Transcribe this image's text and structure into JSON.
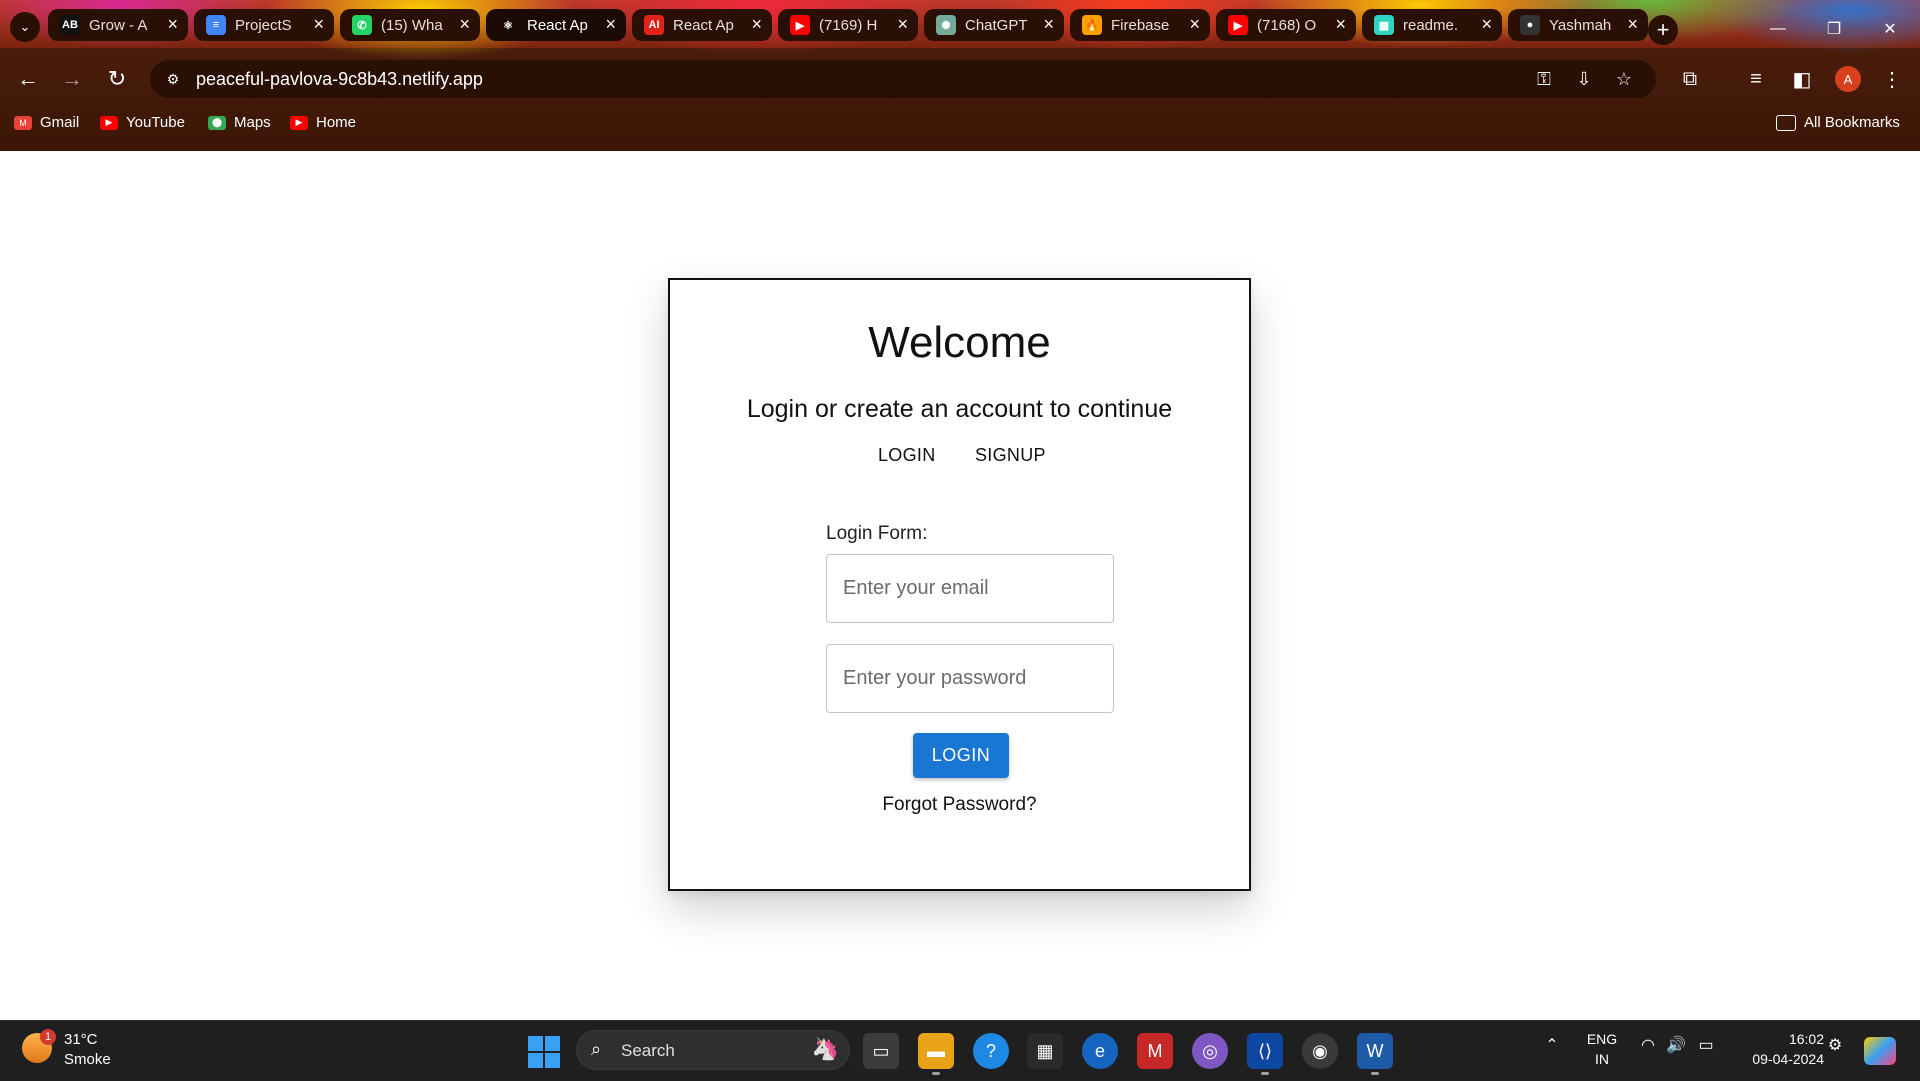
{
  "browser": {
    "tabs": [
      {
        "title": "Grow - A",
        "icon": "ab-icon",
        "color": "#111111",
        "glyph": "AB"
      },
      {
        "title": "ProjectS",
        "icon": "google-docs-icon",
        "color": "#4285f4",
        "glyph": "≡"
      },
      {
        "title": "(15) Wha",
        "icon": "whatsapp-icon",
        "color": "#25d366",
        "glyph": "✆"
      },
      {
        "title": "React Ap",
        "icon": "react-icon",
        "color": "#1a0a03",
        "glyph": "⚛",
        "active": true
      },
      {
        "title": "React Ap",
        "icon": "ai-icon",
        "color": "#e2231a",
        "glyph": "AI"
      },
      {
        "title": "(7169) H",
        "icon": "youtube-icon",
        "color": "#ff0000",
        "glyph": "▶"
      },
      {
        "title": "ChatGPT",
        "icon": "chatgpt-icon",
        "color": "#74aa9c",
        "glyph": "✺"
      },
      {
        "title": "Firebase",
        "icon": "firebase-icon",
        "color": "#ffa000",
        "glyph": "🔥"
      },
      {
        "title": "(7168) O",
        "icon": "youtube-icon",
        "color": "#ff0000",
        "glyph": "▶"
      },
      {
        "title": "readme.",
        "icon": "readme-icon",
        "color": "#2dd4bf",
        "glyph": "▦"
      },
      {
        "title": "Yashmah",
        "icon": "github-icon",
        "color": "#333333",
        "glyph": "●"
      }
    ],
    "url": "peaceful-pavlova-9c8b43.netlify.app",
    "profile_initial": "A",
    "bookmarks": [
      {
        "label": "Gmail",
        "icon": "gmail-icon",
        "color": "#ea4335",
        "glyph": "M"
      },
      {
        "label": "YouTube",
        "icon": "youtube-icon",
        "color": "#ff0000",
        "glyph": "▶"
      },
      {
        "label": "Maps",
        "icon": "maps-icon",
        "color": "#34a853",
        "glyph": "⬤"
      },
      {
        "label": "Home",
        "icon": "youtube-icon",
        "color": "#ff0000",
        "glyph": "▶"
      }
    ],
    "all_bookmarks": "All Bookmarks"
  },
  "page": {
    "title": "Welcome",
    "subtitle": "Login or create an account to continue",
    "tabs": [
      "LOGIN",
      "SIGNUP"
    ],
    "form_label": "Login Form:",
    "email_placeholder": "Enter your email",
    "password_placeholder": "Enter your password",
    "login_button": "LOGIN",
    "forgot_password": "Forgot Password?",
    "accent_color": "#1976d2"
  },
  "taskbar": {
    "weather_temp": "31°C",
    "weather_desc": "Smoke",
    "weather_badge": "1",
    "search_placeholder": "Search",
    "language_top": "ENG",
    "language_bottom": "IN",
    "time": "16:02",
    "date": "09-04-2024"
  }
}
